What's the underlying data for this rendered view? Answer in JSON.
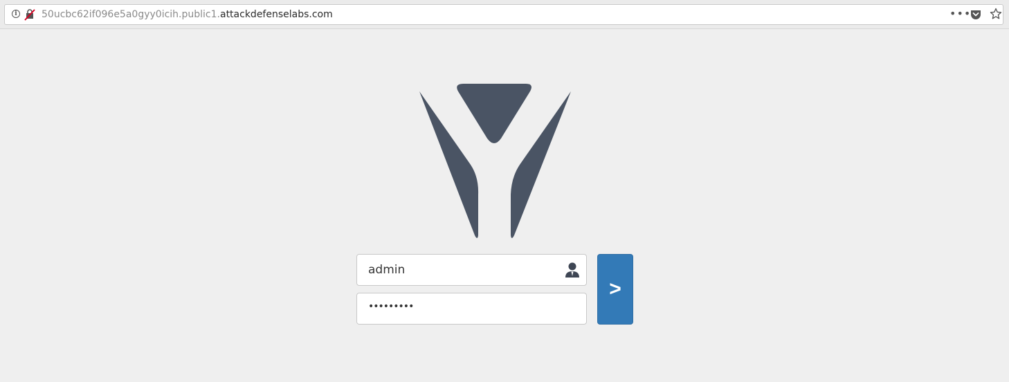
{
  "browser": {
    "url_prefix": "50ucbc62if096e5a0gyy0icih.public1.",
    "url_domain": "attackdefenselabs.com",
    "info_glyph": "i",
    "page_actions_glyph": "•••",
    "icons": [
      "info-icon",
      "insecure-connection-icon",
      "page-actions-icon",
      "pocket-icon",
      "bookmark-star-icon"
    ]
  },
  "login": {
    "username_value": "admin",
    "password_mask": "•••••••••",
    "submit_label": ">",
    "icons": [
      "user-icon"
    ]
  },
  "colors": {
    "page_background": "#efefef",
    "logo": "#4a5464",
    "button": "#337ab7",
    "button_text": "#ffffff"
  }
}
